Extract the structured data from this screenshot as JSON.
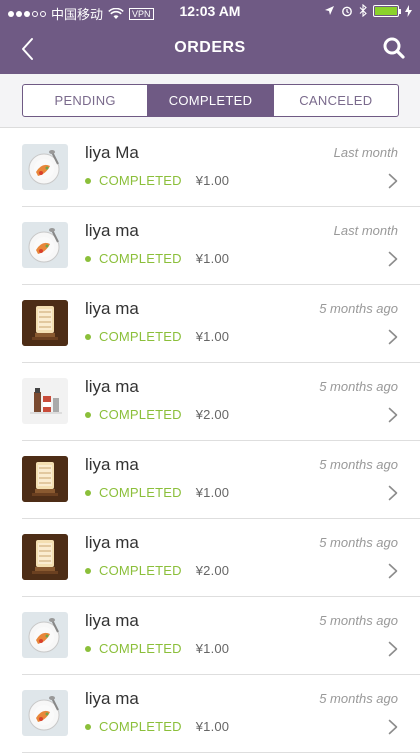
{
  "status_bar": {
    "carrier": "中国移动",
    "vpn": "VPN",
    "time": "12:03 AM"
  },
  "nav": {
    "title": "ORDERS",
    "back_icon": "chevron-left-icon",
    "search_icon": "search-icon"
  },
  "tabs": [
    {
      "label": "PENDING",
      "active": false
    },
    {
      "label": "COMPLETED",
      "active": true
    },
    {
      "label": "CANCELED",
      "active": false
    }
  ],
  "orders": [
    {
      "name": "liya Ma",
      "status": "COMPLETED",
      "price": "¥1.00",
      "time": "Last month",
      "thumb": "plate"
    },
    {
      "name": "liya ma",
      "status": "COMPLETED",
      "price": "¥1.00",
      "time": "Last month",
      "thumb": "plate"
    },
    {
      "name": "liya ma",
      "status": "COMPLETED",
      "price": "¥1.00",
      "time": "5 months ago",
      "thumb": "lamp"
    },
    {
      "name": "liya ma",
      "status": "COMPLETED",
      "price": "¥2.00",
      "time": "5 months ago",
      "thumb": "bottles"
    },
    {
      "name": "liya ma",
      "status": "COMPLETED",
      "price": "¥1.00",
      "time": "5 months ago",
      "thumb": "lamp"
    },
    {
      "name": "liya ma",
      "status": "COMPLETED",
      "price": "¥2.00",
      "time": "5 months ago",
      "thumb": "lamp"
    },
    {
      "name": "liya ma",
      "status": "COMPLETED",
      "price": "¥1.00",
      "time": "5 months ago",
      "thumb": "plate"
    },
    {
      "name": "liya ma",
      "status": "COMPLETED",
      "price": "¥1.00",
      "time": "5 months ago",
      "thumb": "plate"
    }
  ],
  "colors": {
    "header": "#6f5a84",
    "status_green": "#8bbf3a"
  }
}
